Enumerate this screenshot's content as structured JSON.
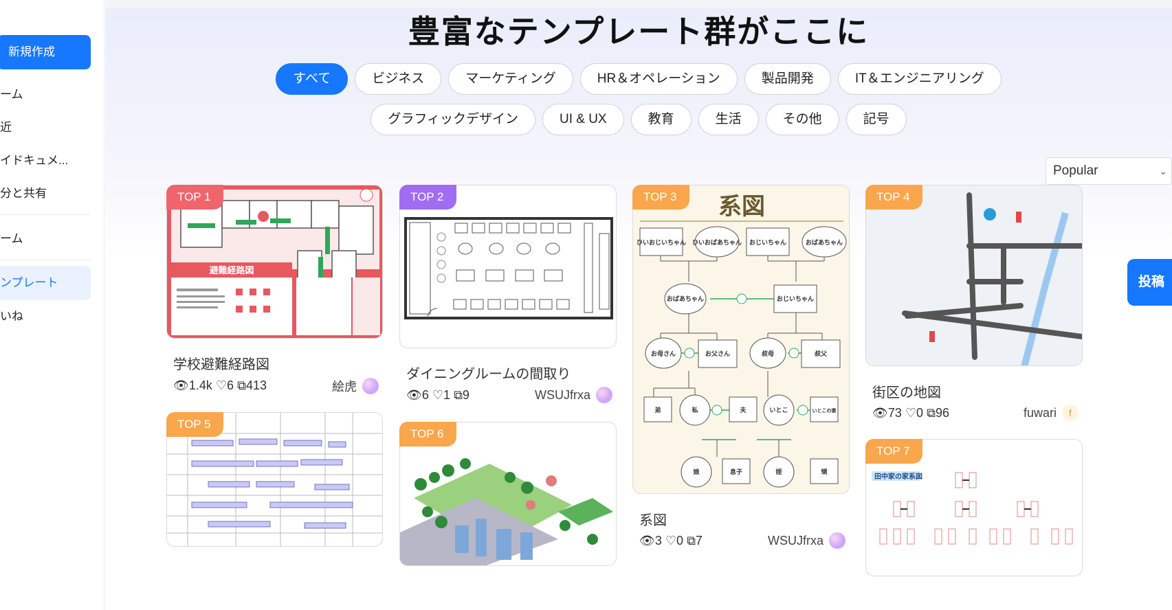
{
  "sidebar": {
    "new_button": "新規作成",
    "items": [
      "ーム",
      "近",
      "イドキュメ...",
      "分と共有",
      "ーム",
      "ンプレート",
      "いね"
    ]
  },
  "main": {
    "title": "豊富なテンプレート群がここに",
    "categories_row1": [
      "すべて",
      "ビジネス",
      "マーケティング",
      "HR＆オペレーション",
      "製品開発",
      "IT＆エンジニアリング"
    ],
    "categories_row2": [
      "グラフィックデザイン",
      "UI & UX",
      "教育",
      "生活",
      "その他",
      "記号"
    ],
    "active_category": "すべて",
    "sort": {
      "selected": "Popular"
    },
    "post_button": "投稿"
  },
  "cards": [
    {
      "rank": "TOP 1",
      "title": "学校避難経路図",
      "views": "1.4k",
      "likes": "6",
      "copies": "413",
      "author": "絵虎",
      "thumb_title": "避難経路図"
    },
    {
      "rank": "TOP 2",
      "title": "ダイニングルームの間取り",
      "views": "6",
      "likes": "1",
      "copies": "9",
      "author": "WSUJfrxa"
    },
    {
      "rank": "TOP 3",
      "title": "系図",
      "views": "3",
      "likes": "0",
      "copies": "7",
      "author": "WSUJfrxa",
      "thumb_title": "系図"
    },
    {
      "rank": "TOP 4",
      "title": "街区の地図",
      "views": "73",
      "likes": "0",
      "copies": "96",
      "author": "fuwari",
      "avatar_letter": "f"
    },
    {
      "rank": "TOP 5"
    },
    {
      "rank": "TOP 6"
    },
    {
      "rank": "TOP 7",
      "thumb_title": "田中家の家系図"
    }
  ],
  "family_tree_labels": {
    "gen1": [
      "ひいおじいちゃん",
      "ひいおばあちゃん",
      "おじいちゃん",
      "おばあちゃん"
    ],
    "gen2": [
      "おばあちゃん",
      "おじいちゃん"
    ],
    "gen3": [
      "お母さん",
      "お父さん",
      "叔母",
      "叔父"
    ],
    "gen4": [
      "弟",
      "私",
      "夫",
      "いとこ",
      "いとこの妻"
    ],
    "gen5": [
      "娘",
      "息子",
      "姪",
      "甥"
    ]
  },
  "icons": {
    "view": "eye-icon",
    "like": "heart-icon",
    "copy": "copy-icon",
    "sort": "chevron-down-icon"
  },
  "colors": {
    "accent": "#1677ff",
    "top1": "#f0646d",
    "top2": "#a06cf0",
    "top3": "#f9a64c"
  }
}
